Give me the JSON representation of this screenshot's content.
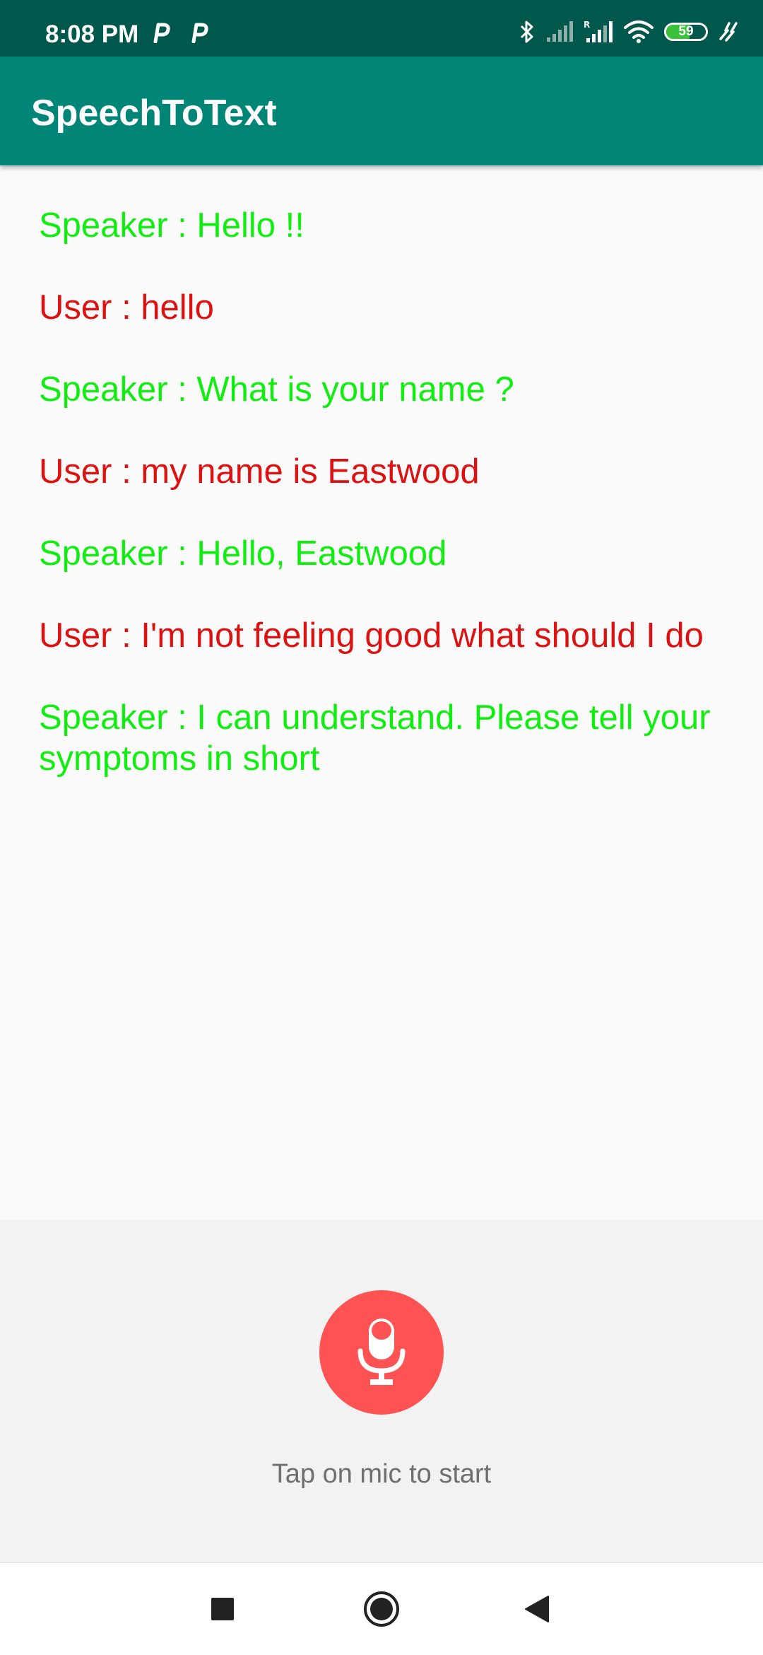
{
  "status_bar": {
    "time": "8:08 PM",
    "battery_level": "59",
    "battery_percent": 59,
    "icons": [
      "p-app-icon",
      "p-app-icon",
      "bluetooth-icon",
      "signal-icon",
      "signal-roaming-icon",
      "wifi-icon",
      "battery-icon",
      "charging-icon"
    ]
  },
  "app_bar": {
    "title": "SpeechToText",
    "color": "#008577"
  },
  "conversation": [
    {
      "role": "speaker",
      "text": "Speaker : Hello !!"
    },
    {
      "role": "user",
      "text": "User : hello"
    },
    {
      "role": "speaker",
      "text": "Speaker : What is your name ?"
    },
    {
      "role": "user",
      "text": "User : my name is Eastwood"
    },
    {
      "role": "speaker",
      "text": "Speaker : Hello, Eastwood"
    },
    {
      "role": "user",
      "text": "User : I'm not feeling good what should I do"
    },
    {
      "role": "speaker",
      "text": "Speaker : I can understand. Please tell your symptoms in short"
    }
  ],
  "colors": {
    "speaker": "#10ee10",
    "user": "#dd1111",
    "mic_button": "#ff5252"
  },
  "mic": {
    "icon": "microphone-icon",
    "hint": "Tap on mic to start"
  },
  "nav_bar": {
    "buttons": [
      "recents-icon",
      "home-icon",
      "back-icon"
    ]
  }
}
